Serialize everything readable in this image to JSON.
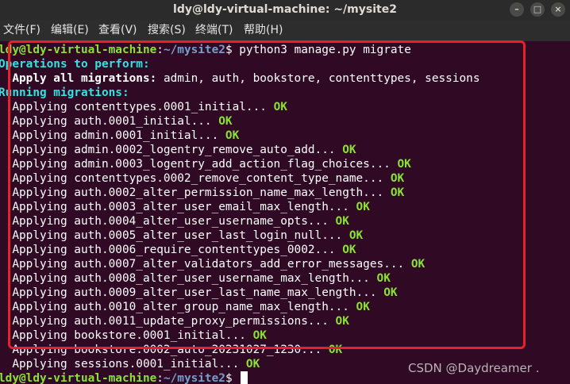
{
  "window": {
    "title": "ldy@ldy-virtual-machine: ~/mysite2"
  },
  "menu": [
    "文件(F)",
    "编辑(E)",
    "查看(V)",
    "搜索(S)",
    "终端(T)",
    "帮助(H)"
  ],
  "prompt": {
    "user_host": "ldy@ldy-virtual-machine",
    "sep": ":",
    "path": "~/mysite2",
    "symbol": "$"
  },
  "command": " python3 manage.py migrate",
  "ops_header": "Operations to perform:",
  "apply_all_label": "  Apply all migrations:",
  "apply_all_apps": " admin, auth, bookstore, contenttypes, sessions",
  "running_header": "Running migrations:",
  "migrations": [
    {
      "text": "  Applying contenttypes.0001_initial...",
      "status": "OK"
    },
    {
      "text": "  Applying auth.0001_initial...",
      "status": "OK"
    },
    {
      "text": "  Applying admin.0001_initial...",
      "status": "OK"
    },
    {
      "text": "  Applying admin.0002_logentry_remove_auto_add...",
      "status": "OK"
    },
    {
      "text": "  Applying admin.0003_logentry_add_action_flag_choices...",
      "status": "OK"
    },
    {
      "text": "  Applying contenttypes.0002_remove_content_type_name...",
      "status": "OK"
    },
    {
      "text": "  Applying auth.0002_alter_permission_name_max_length...",
      "status": "OK"
    },
    {
      "text": "  Applying auth.0003_alter_user_email_max_length...",
      "status": "OK"
    },
    {
      "text": "  Applying auth.0004_alter_user_username_opts...",
      "status": "OK"
    },
    {
      "text": "  Applying auth.0005_alter_user_last_login_null...",
      "status": "OK"
    },
    {
      "text": "  Applying auth.0006_require_contenttypes_0002...",
      "status": "OK"
    },
    {
      "text": "  Applying auth.0007_alter_validators_add_error_messages...",
      "status": "OK"
    },
    {
      "text": "  Applying auth.0008_alter_user_username_max_length...",
      "status": "OK"
    },
    {
      "text": "  Applying auth.0009_alter_user_last_name_max_length...",
      "status": "OK"
    },
    {
      "text": "  Applying auth.0010_alter_group_name_max_length...",
      "status": "OK"
    },
    {
      "text": "  Applying auth.0011_update_proxy_permissions...",
      "status": "OK"
    },
    {
      "text": "  Applying bookstore.0001_initial...",
      "status": "OK"
    },
    {
      "text": "  Applying bookstore.0002_auto_20231027_1230...",
      "status": "OK"
    },
    {
      "text": "  Applying sessions.0001_initial...",
      "status": "OK"
    }
  ],
  "watermark": "CSDN @Daydreamer  .",
  "colors": {
    "background": "#300a24",
    "prompt_green": "#8ae234",
    "path_blue": "#729fcf",
    "header_cyan": "#34e2e2",
    "highlight_red": "#e8202a"
  }
}
